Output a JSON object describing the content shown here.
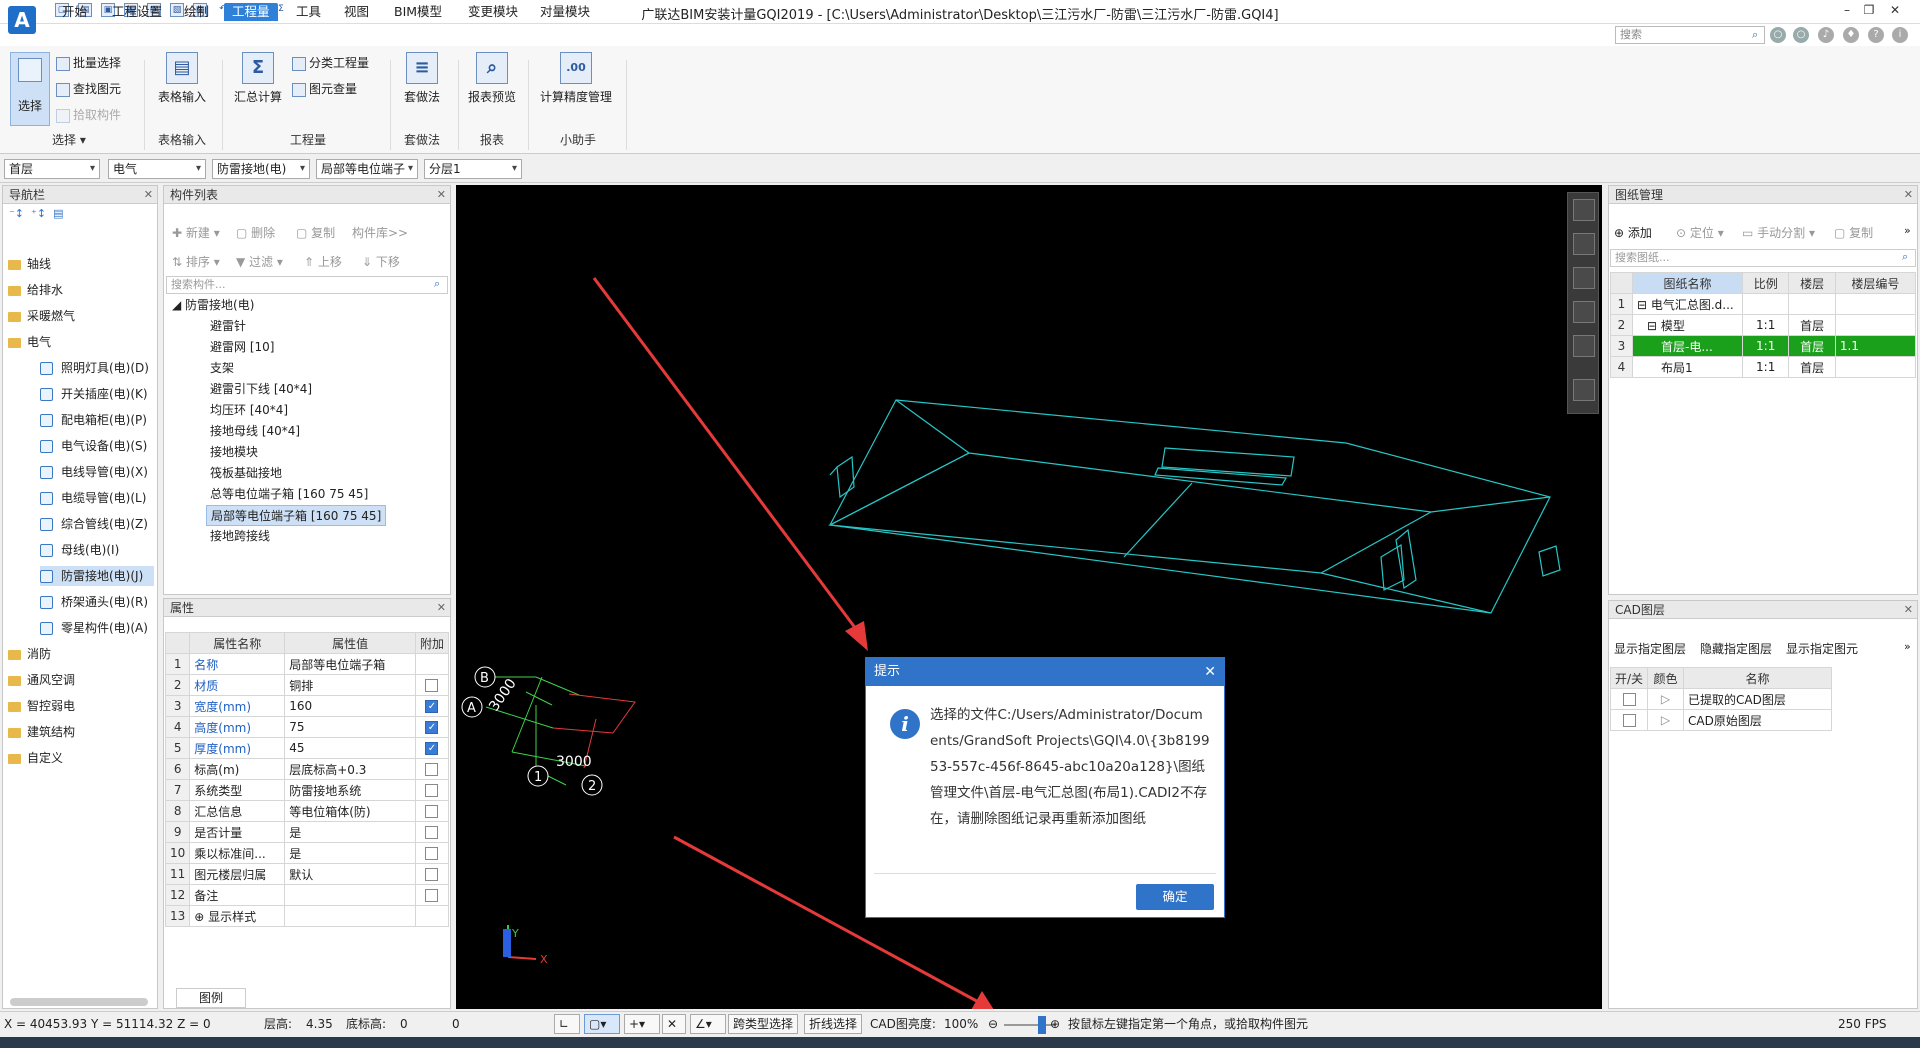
{
  "app": {
    "title": "广联达BIM安装计量GQI2019 - [C:\\Users\\Administrator\\Desktop\\三江污水厂-防雷\\三江污水厂-防雷.GQI4]",
    "logo_letter": "A"
  },
  "menu": [
    "开始",
    "工程设置",
    "绘制",
    "工程量",
    "工具",
    "视图",
    "BIM模型",
    "变更模块",
    "对量模块"
  ],
  "menu_active": "工程量",
  "search_placeholder": "搜索",
  "ribbon": {
    "select_group": {
      "select": "选择",
      "batch_select": "批量选择",
      "find_element": "查找图元",
      "pick_component": "拾取构件",
      "label": "选择"
    },
    "table_group": {
      "table_input": "表格输入",
      "label": "表格输入"
    },
    "qty_group": {
      "summary_calc": "汇总计算",
      "category_qty": "分类工程量",
      "element_qty": "图元查量",
      "label": "工程量"
    },
    "method_group": {
      "apply_method": "套做法",
      "label": "套做法"
    },
    "report_group": {
      "report_preview": "报表预览",
      "label": "报表"
    },
    "helper_group": {
      "precision": "计算精度管理",
      "label": "小助手"
    }
  },
  "filters": [
    "首层",
    "电气",
    "防雷接地(电)",
    "局部等电位端子",
    "分层1"
  ],
  "nav": {
    "title": "导航栏",
    "items": [
      {
        "label": "轴线",
        "type": "folder"
      },
      {
        "label": "给排水",
        "type": "folder"
      },
      {
        "label": "采暖燃气",
        "type": "folder"
      },
      {
        "label": "电气",
        "type": "folder"
      },
      {
        "label": "照明灯具(电)(D)",
        "type": "sub"
      },
      {
        "label": "开关插座(电)(K)",
        "type": "sub"
      },
      {
        "label": "配电箱柜(电)(P)",
        "type": "sub"
      },
      {
        "label": "电气设备(电)(S)",
        "type": "sub"
      },
      {
        "label": "电线导管(电)(X)",
        "type": "sub"
      },
      {
        "label": "电缆导管(电)(L)",
        "type": "sub"
      },
      {
        "label": "综合管线(电)(Z)",
        "type": "sub"
      },
      {
        "label": "母线(电)(I)",
        "type": "sub"
      },
      {
        "label": "防雷接地(电)(J)",
        "type": "sub",
        "selected": true
      },
      {
        "label": "桥架通头(电)(R)",
        "type": "sub"
      },
      {
        "label": "零星构件(电)(A)",
        "type": "sub"
      },
      {
        "label": "消防",
        "type": "folder"
      },
      {
        "label": "通风空调",
        "type": "folder"
      },
      {
        "label": "智控弱电",
        "type": "folder"
      },
      {
        "label": "建筑结构",
        "type": "folder"
      },
      {
        "label": "自定义",
        "type": "folder"
      }
    ]
  },
  "component_list": {
    "title": "构件列表",
    "toolbar1": [
      "新建",
      "删除",
      "复制",
      "构件库>>"
    ],
    "toolbar2": [
      "排序",
      "过滤",
      "上移",
      "下移"
    ],
    "search_placeholder": "搜索构件...",
    "root": "防雷接地(电)",
    "items": [
      "避雷针",
      "避雷网 [10]",
      "支架",
      "避雷引下线 [40*4]",
      "均压环 [40*4]",
      "接地母线 [40*4]",
      "接地模块",
      "筏板基础接地",
      "总等电位端子箱 [160 75 45]",
      "局部等电位端子箱 [160 75 45]",
      "接地跨接线"
    ],
    "selected_index": 9
  },
  "properties": {
    "title": "属性",
    "headers": [
      "属性名称",
      "属性值",
      "附加"
    ],
    "rows": [
      {
        "n": "1",
        "name": "名称",
        "value": "局部等电位端子箱",
        "blue": true,
        "cb": ""
      },
      {
        "n": "2",
        "name": "材质",
        "value": "铜排",
        "blue": true,
        "cb": "off"
      },
      {
        "n": "3",
        "name": "宽度(mm)",
        "value": "160",
        "blue": true,
        "cb": "on"
      },
      {
        "n": "4",
        "name": "高度(mm)",
        "value": "75",
        "blue": true,
        "cb": "on"
      },
      {
        "n": "5",
        "name": "厚度(mm)",
        "value": "45",
        "blue": true,
        "cb": "on"
      },
      {
        "n": "6",
        "name": "标高(m)",
        "value": "层底标高+0.3",
        "blue": false,
        "cb": "off"
      },
      {
        "n": "7",
        "name": "系统类型",
        "value": "防雷接地系统",
        "blue": false,
        "cb": "off"
      },
      {
        "n": "8",
        "name": "汇总信息",
        "value": "等电位箱体(防)",
        "blue": false,
        "cb": "off"
      },
      {
        "n": "9",
        "name": "是否计量",
        "value": "是",
        "blue": false,
        "cb": "off"
      },
      {
        "n": "10",
        "name": "乘以标准间...",
        "value": "是",
        "blue": false,
        "cb": "off"
      },
      {
        "n": "11",
        "name": "图元楼层归属",
        "value": "默认",
        "blue": false,
        "cb": "off"
      },
      {
        "n": "12",
        "name": "备注",
        "value": "",
        "blue": false,
        "cb": "off"
      },
      {
        "n": "13",
        "name": "⊕ 显示样式",
        "value": "",
        "blue": false,
        "cb": ""
      }
    ],
    "tab": "图例"
  },
  "canvas": {
    "axis_labels": {
      "b": "B",
      "a": "A",
      "one": "1",
      "two": "2",
      "dim_v": "3000",
      "dim_h": "3000"
    },
    "coord_y": "Y",
    "coord_x": "X"
  },
  "dialog": {
    "title": "提示",
    "message": "选择的文件C:/Users/Administrator/Documents/GrandSoft Projects\\GQI\\4.0\\{3b819953-557c-456f-8645-abc10a20a128}\\图纸管理文件\\首层-电气汇总图(布局1).CADI2不存在，请删除图纸记录再重新添加图纸",
    "ok": "确定"
  },
  "drawing_mgmt": {
    "title": "图纸管理",
    "toolbar": [
      "添加",
      "定位",
      "手动分割",
      "复制"
    ],
    "search_placeholder": "搜索图纸...",
    "headers": [
      "图纸名称",
      "比例",
      "楼层",
      "楼层编号"
    ],
    "rows": [
      {
        "n": "1",
        "name": "⊟ 电气汇总图.d...",
        "scale": "",
        "floor": "",
        "code": ""
      },
      {
        "n": "2",
        "name": "⊟ 模型",
        "scale": "1:1",
        "floor": "首层",
        "code": ""
      },
      {
        "n": "3",
        "name": "首层-电...",
        "scale": "1:1",
        "floor": "首层",
        "code": "1.1",
        "green": true
      },
      {
        "n": "4",
        "name": "布局1",
        "scale": "1:1",
        "floor": "首层",
        "code": ""
      }
    ]
  },
  "cad_layers": {
    "title": "CAD图层",
    "toolbar": [
      "显示指定图层",
      "隐藏指定图层",
      "显示指定图元"
    ],
    "headers": [
      "开/关",
      "颜色",
      "名称"
    ],
    "rows": [
      "已提取的CAD图层",
      "CAD原始图层"
    ]
  },
  "status": {
    "coords": "X = 40453.93 Y = 51114.32 Z = 0",
    "floor_height_label": "层高:",
    "floor_height": "4.35",
    "bottom_label": "底标高:",
    "bottom": "0",
    "extra": "0",
    "cross_type_select": "跨类型选择",
    "polyline_select": "折线选择",
    "cad_brightness_label": "CAD图亮度:",
    "cad_brightness": "100%",
    "hint": "按鼠标左键指定第一个角点，或拾取构件图元",
    "fps": "250 FPS"
  },
  "colors": {
    "accent": "#2f74c8",
    "wire": "#27c6c6",
    "arrow": "#e63a3a",
    "green_row": "#1aa01a"
  }
}
